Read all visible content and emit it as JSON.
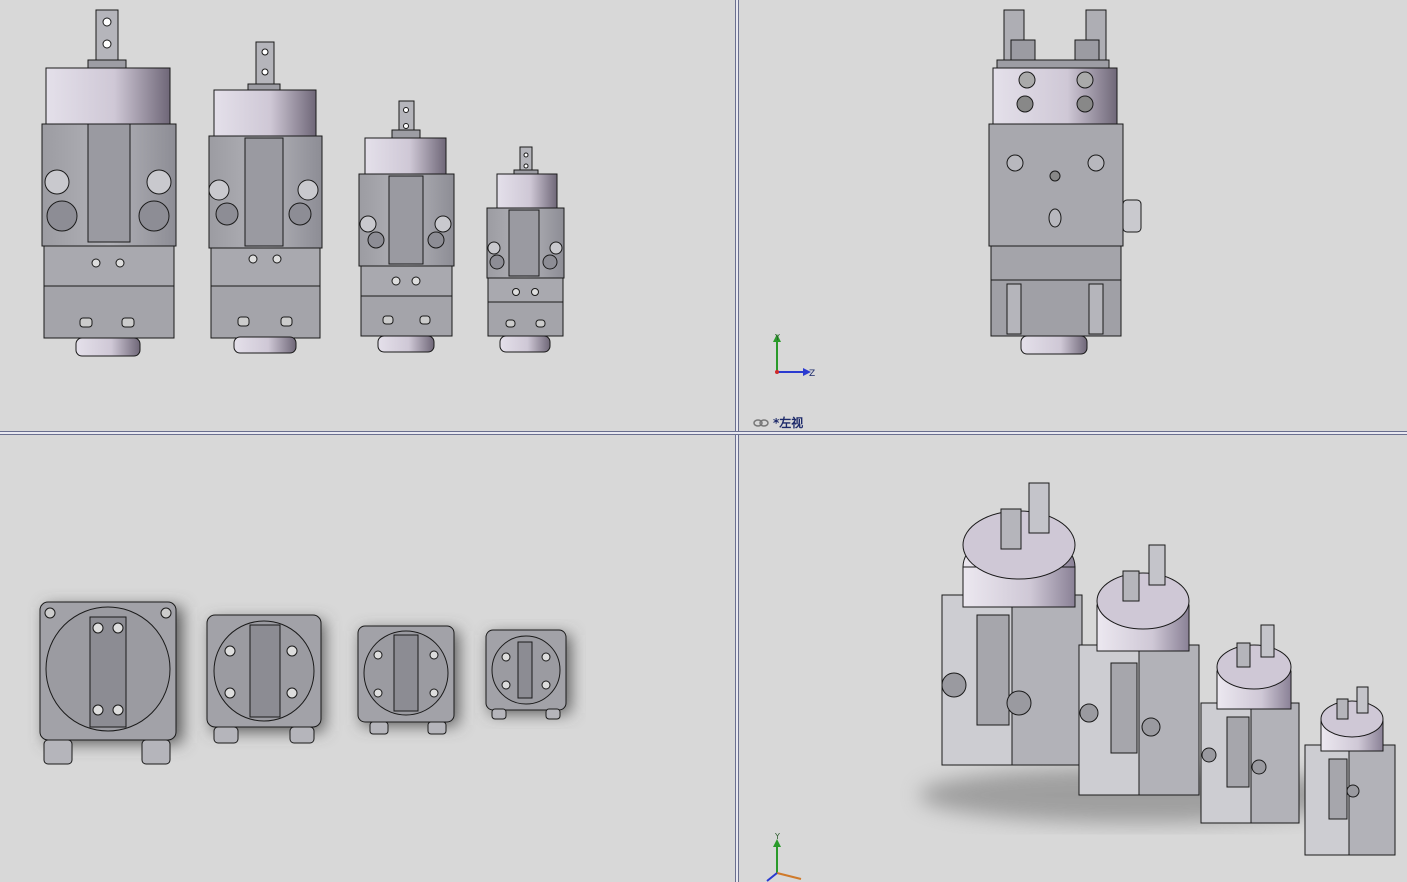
{
  "viewports": {
    "top_left": {
      "name": "front-view"
    },
    "top_right": {
      "name": "left-view",
      "label": "*左视",
      "axis": {
        "y": "Y",
        "z": "Z"
      }
    },
    "bottom_left": {
      "name": "bottom-view"
    },
    "bottom_right": {
      "name": "isometric-view",
      "axis": {
        "y": "Y"
      }
    }
  },
  "colors": {
    "background": "#d8d8d8",
    "body": "#a7a7ad",
    "metal_light": "#d8d3df",
    "metal_dark": "#6f6778",
    "edge": "#1a1a1a",
    "divider": "#6a6f8f"
  }
}
